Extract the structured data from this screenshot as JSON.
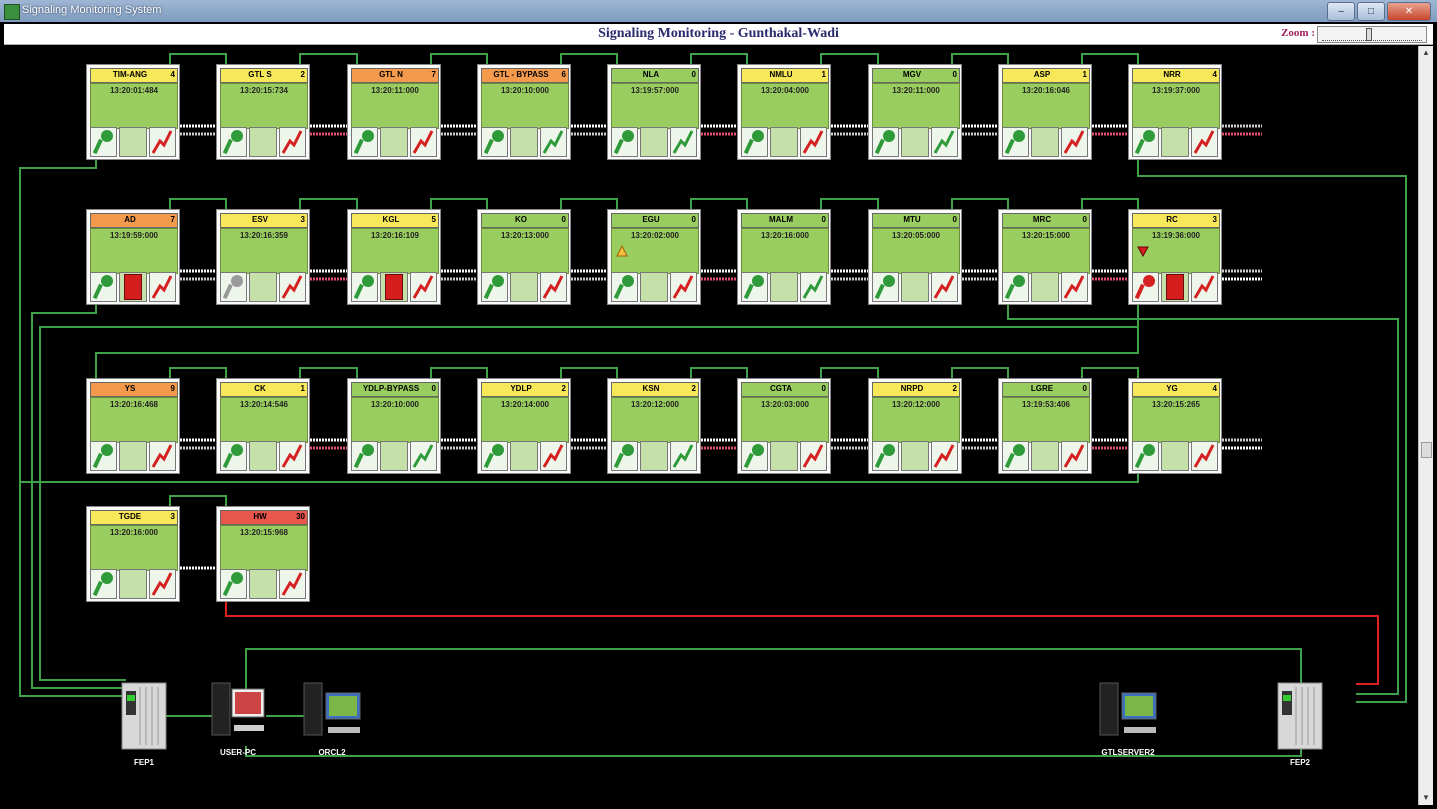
{
  "window": {
    "title": "Signaling Monitoring System",
    "buttons": [
      "–",
      "□",
      "✕"
    ]
  },
  "header": {
    "title": "Signaling Monitoring - Gunthakal-Wadi",
    "zoom_label": "Zoom :"
  },
  "colors": {
    "yellow": "#f7e85a",
    "orange": "#f39a4d",
    "red": "#e8564c",
    "green": "#9acd5f",
    "wire_green": "#3fa04a",
    "wire_red": "#e02020"
  },
  "stations": [
    {
      "name": "TIM-ANG",
      "count": "4",
      "time": "13:20:01:484",
      "head": "yellow",
      "key": "green",
      "door": "normal",
      "power": "red"
    },
    {
      "name": "GTL S",
      "count": "2",
      "time": "13:20:15:734",
      "head": "yellow",
      "key": "green",
      "door": "normal",
      "power": "red"
    },
    {
      "name": "GTL N",
      "count": "7",
      "time": "13:20:11:000",
      "head": "orange",
      "key": "green",
      "door": "normal",
      "power": "red"
    },
    {
      "name": "GTL - BYPASS",
      "count": "6",
      "time": "13:20:10:000",
      "head": "orange",
      "key": "green",
      "door": "normal",
      "power": "green"
    },
    {
      "name": "NLA",
      "count": "0",
      "time": "13:19:57:000",
      "head": "green",
      "key": "green",
      "door": "normal",
      "power": "green"
    },
    {
      "name": "NMLU",
      "count": "1",
      "time": "13:20:04:000",
      "head": "yellow",
      "key": "green",
      "door": "normal",
      "power": "red"
    },
    {
      "name": "MGV",
      "count": "0",
      "time": "13:20:11:000",
      "head": "green",
      "key": "green",
      "door": "normal",
      "power": "green"
    },
    {
      "name": "ASP",
      "count": "1",
      "time": "13:20:16:046",
      "head": "yellow",
      "key": "green",
      "door": "normal",
      "power": "red"
    },
    {
      "name": "NRR",
      "count": "4",
      "time": "13:19:37:000",
      "head": "yellow",
      "key": "green",
      "door": "normal",
      "power": "red"
    },
    {
      "name": "AD",
      "count": "7",
      "time": "13:19:59:000",
      "head": "orange",
      "key": "green",
      "door": "open",
      "power": "red"
    },
    {
      "name": "ESV",
      "count": "3",
      "time": "13:20:16:359",
      "head": "yellow",
      "key": "grey",
      "door": "normal",
      "power": "red"
    },
    {
      "name": "KGL",
      "count": "5",
      "time": "13:20:16:109",
      "head": "yellow",
      "key": "green",
      "door": "open",
      "power": "red"
    },
    {
      "name": "KO",
      "count": "0",
      "time": "13:20:13:000",
      "head": "green",
      "key": "green",
      "door": "normal",
      "power": "red"
    },
    {
      "name": "EGU",
      "count": "0",
      "time": "13:20:02:000",
      "head": "green",
      "key": "green",
      "door": "normal",
      "power": "red",
      "alarm": "orange"
    },
    {
      "name": "MALM",
      "count": "0",
      "time": "13:20:16:000",
      "head": "green",
      "key": "green",
      "door": "normal",
      "power": "green"
    },
    {
      "name": "MTU",
      "count": "0",
      "time": "13:20:05:000",
      "head": "green",
      "key": "green",
      "door": "normal",
      "power": "red"
    },
    {
      "name": "MRC",
      "count": "0",
      "time": "13:20:15:000",
      "head": "green",
      "key": "green",
      "door": "normal",
      "power": "red"
    },
    {
      "name": "RC",
      "count": "3",
      "time": "13:19:36:000",
      "head": "yellow",
      "key": "red",
      "door": "open",
      "power": "red",
      "alarm": "red"
    },
    {
      "name": "YS",
      "count": "9",
      "time": "13:20:16:468",
      "head": "orange",
      "key": "green",
      "door": "normal",
      "power": "red"
    },
    {
      "name": "CK",
      "count": "1",
      "time": "13:20:14:546",
      "head": "yellow",
      "key": "green",
      "door": "normal",
      "power": "red"
    },
    {
      "name": "YDLP-BYPASS",
      "count": "0",
      "time": "13:20:10:000",
      "head": "green",
      "key": "green",
      "door": "normal",
      "power": "green"
    },
    {
      "name": "YDLP",
      "count": "2",
      "time": "13:20:14:000",
      "head": "yellow",
      "key": "green",
      "door": "normal",
      "power": "red"
    },
    {
      "name": "KSN",
      "count": "2",
      "time": "13:20:12:000",
      "head": "yellow",
      "key": "green",
      "door": "normal",
      "power": "green"
    },
    {
      "name": "CGTA",
      "count": "0",
      "time": "13:20:03:000",
      "head": "green",
      "key": "green",
      "door": "normal",
      "power": "red"
    },
    {
      "name": "NRPD",
      "count": "2",
      "time": "13:20:12:000",
      "head": "yellow",
      "key": "green",
      "door": "normal",
      "power": "red"
    },
    {
      "name": "LGRE",
      "count": "0",
      "time": "13:19:53:406",
      "head": "green",
      "key": "green",
      "door": "normal",
      "power": "red"
    },
    {
      "name": "YG",
      "count": "4",
      "time": "13:20:15:265",
      "head": "yellow",
      "key": "green",
      "door": "normal",
      "power": "red"
    },
    {
      "name": "TGDE",
      "count": "3",
      "time": "13:20:16:000",
      "head": "yellow",
      "key": "green",
      "door": "normal",
      "power": "red"
    },
    {
      "name": "HW",
      "count": "30",
      "time": "13:20:15:968",
      "head": "red",
      "key": "green",
      "door": "normal",
      "power": "red"
    }
  ],
  "devices": [
    {
      "name": "FEP1",
      "icon": "server-rack-icon"
    },
    {
      "name": "USER-PC",
      "icon": "workstation-icon"
    },
    {
      "name": "ORCL2",
      "icon": "computer-icon"
    },
    {
      "name": "GTLSERVER2",
      "icon": "computer-icon"
    },
    {
      "name": "FEP2",
      "icon": "server-rack-icon"
    }
  ]
}
